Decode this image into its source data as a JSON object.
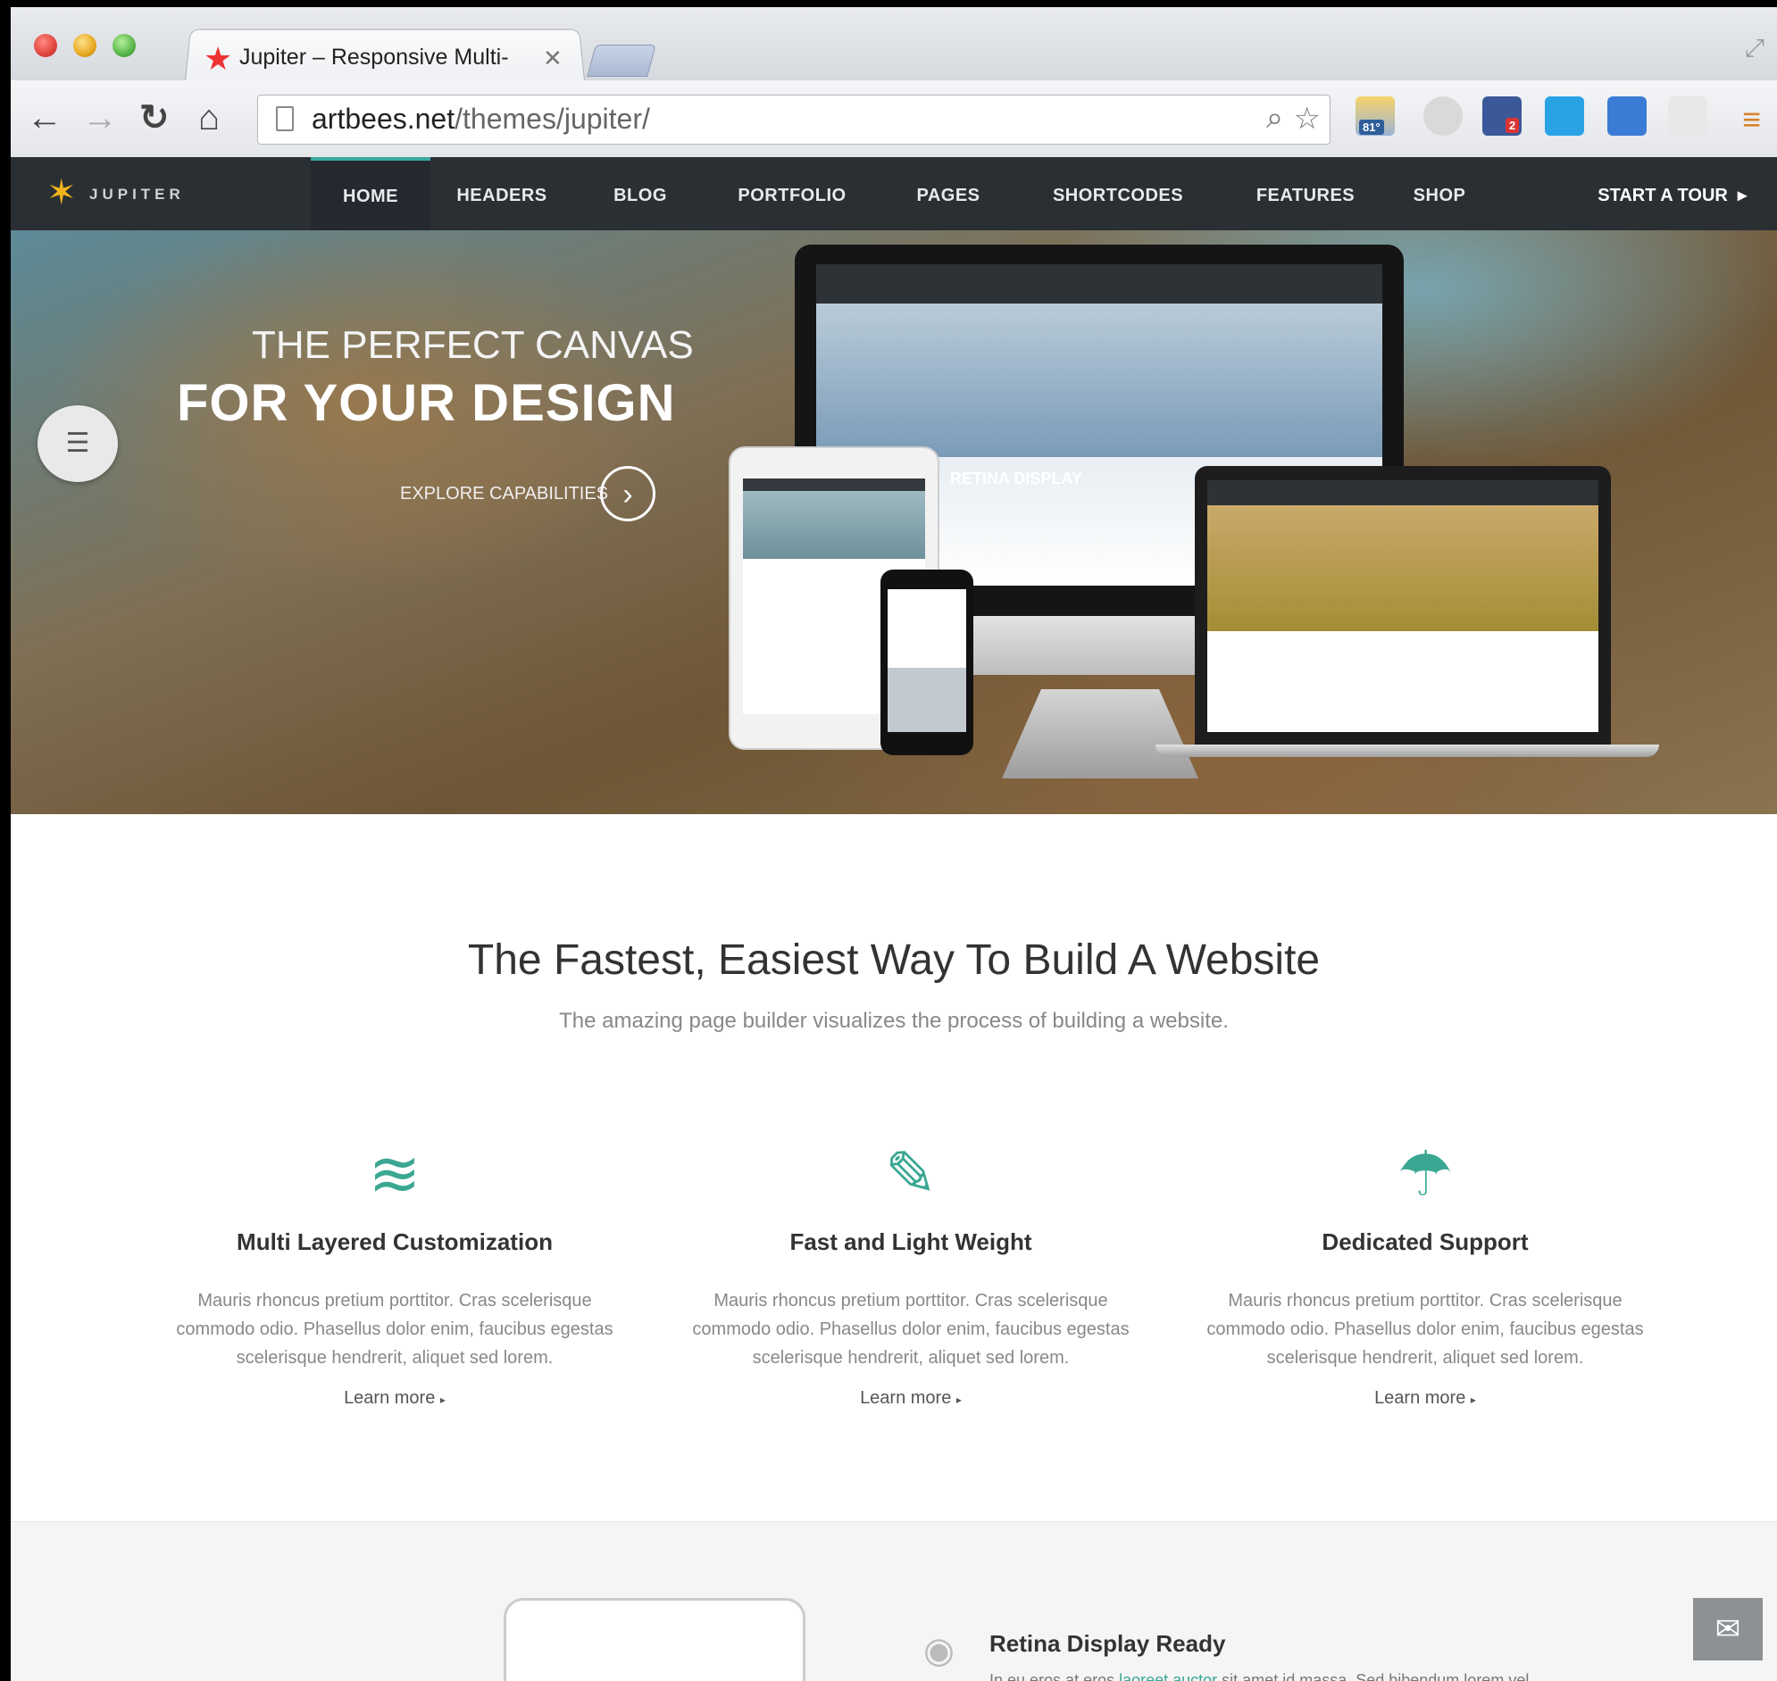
{
  "browser": {
    "tab_title": "Jupiter – Responsive Multi-",
    "url_domain": "artbees.net",
    "url_path": "/themes/jupiter/",
    "weather_badge": "81°",
    "facebook_badge": "2"
  },
  "site": {
    "logo": "JUPITER",
    "nav": [
      "HOME",
      "HEADERS",
      "BLOG",
      "PORTFOLIO",
      "PAGES",
      "SHORTCODES",
      "FEATURES",
      "SHOP"
    ],
    "tour": "START A TOUR"
  },
  "hero": {
    "line1": "THE PERFECT CANVAS",
    "line2": "FOR YOUR DESIGN",
    "link": "EXPLORE CAPABILITIES",
    "retina": "RETINA DISPLAY"
  },
  "section": {
    "title": "The Fastest, Easiest Way To Build A Website",
    "subtitle": "The amazing page builder visualizes the process of building a website."
  },
  "features": [
    {
      "title": "Multi Layered Customization",
      "text": "Mauris rhoncus pretium porttitor. Cras scelerisque commodo odio. Phasellus dolor enim, faucibus egestas scelerisque hendrerit, aliquet sed lorem.",
      "link": "Learn more"
    },
    {
      "title": "Fast and Light Weight",
      "text": "Mauris rhoncus pretium porttitor. Cras scelerisque commodo odio. Phasellus dolor enim, faucibus egestas scelerisque hendrerit, aliquet sed lorem.",
      "link": "Learn more"
    },
    {
      "title": "Dedicated Support",
      "text": "Mauris rhoncus pretium porttitor. Cras scelerisque commodo odio. Phasellus dolor enim, faucibus egestas scelerisque hendrerit, aliquet sed lorem.",
      "link": "Learn more"
    }
  ],
  "band": {
    "title": "Retina Display Ready",
    "text_before": "In eu eros at eros ",
    "text_link": "laoreet auctor",
    "text_after": " sit amet id massa. Sed bibendum lorem vel"
  },
  "colors": {
    "accent": "#3aa792",
    "nav_bg": "#2a2f34",
    "active_tab_border": "#3aa9a0"
  }
}
